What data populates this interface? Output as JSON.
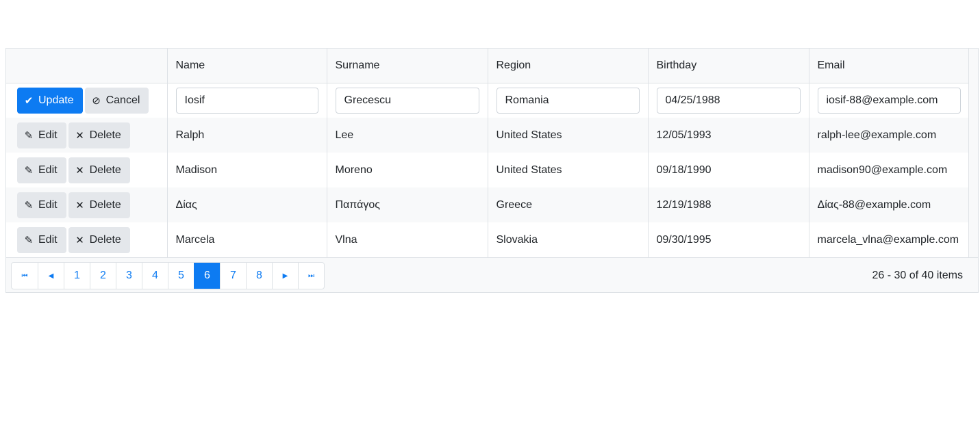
{
  "columns": [
    "Name",
    "Surname",
    "Region",
    "Birthday",
    "Email"
  ],
  "edit_row": {
    "update_label": "Update",
    "cancel_label": "Cancel",
    "values": [
      "Iosif",
      "Grecescu",
      "Romania",
      "04/25/1988",
      "iosif-88@example.com"
    ]
  },
  "row_actions": {
    "edit_label": "Edit",
    "delete_label": "Delete"
  },
  "rows": [
    [
      "Ralph",
      "Lee",
      "United States",
      "12/05/1993",
      "ralph-lee@example.com"
    ],
    [
      "Madison",
      "Moreno",
      "United States",
      "09/18/1990",
      "madison90@example.com"
    ],
    [
      "Δίας",
      "Παπάγος",
      "Greece",
      "12/19/1988",
      "Δίας-88@example.com"
    ],
    [
      "Marcela",
      "Vlna",
      "Slovakia",
      "09/30/1995",
      "marcela_vlna@example.com"
    ]
  ],
  "pager": {
    "pages": [
      "1",
      "2",
      "3",
      "4",
      "5",
      "6",
      "7",
      "8"
    ],
    "current": "6",
    "info": "26 - 30 of 40 items"
  },
  "icons": {
    "first": "first-page-icon",
    "prev": "previous-page-icon",
    "next": "next-page-icon",
    "last": "last-page-icon",
    "check": "check-icon",
    "cancel": "cancel-icon",
    "pencil": "pencil-icon",
    "x": "x-icon"
  },
  "colors": {
    "accent": "#0d7bf2",
    "header_bg": "#f8f9fa",
    "border": "#dee2e6"
  }
}
